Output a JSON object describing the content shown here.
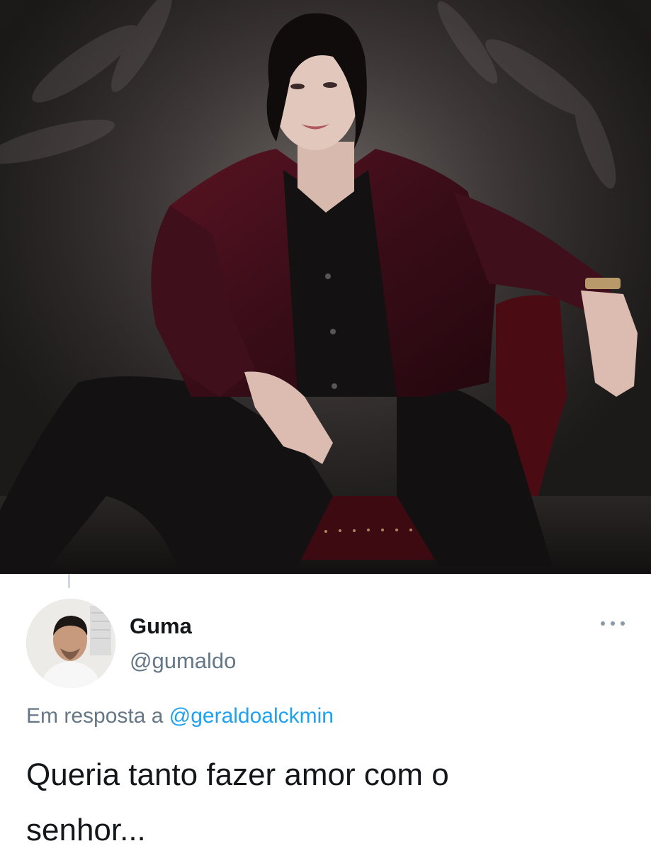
{
  "media": {
    "photo_icon": "photo-image",
    "colors": {
      "backdrop": "#3b3635",
      "jacket": "#3a0d18",
      "shirt": "#141112",
      "chair": "#4a0b12"
    }
  },
  "tweet": {
    "display_name": "Guma",
    "handle": "@gumaldo",
    "reply_prefix": "Em resposta a",
    "reply_mention": "@geraldoalckmin",
    "text_line1": "Queria tanto fazer amor com o",
    "text_line2": "senhor...",
    "more_icon": "more-horizontal-icon",
    "colors": {
      "name": "#14171a",
      "secondary": "#657786",
      "mention": "#1da1f2",
      "more": "#8899a6"
    }
  }
}
